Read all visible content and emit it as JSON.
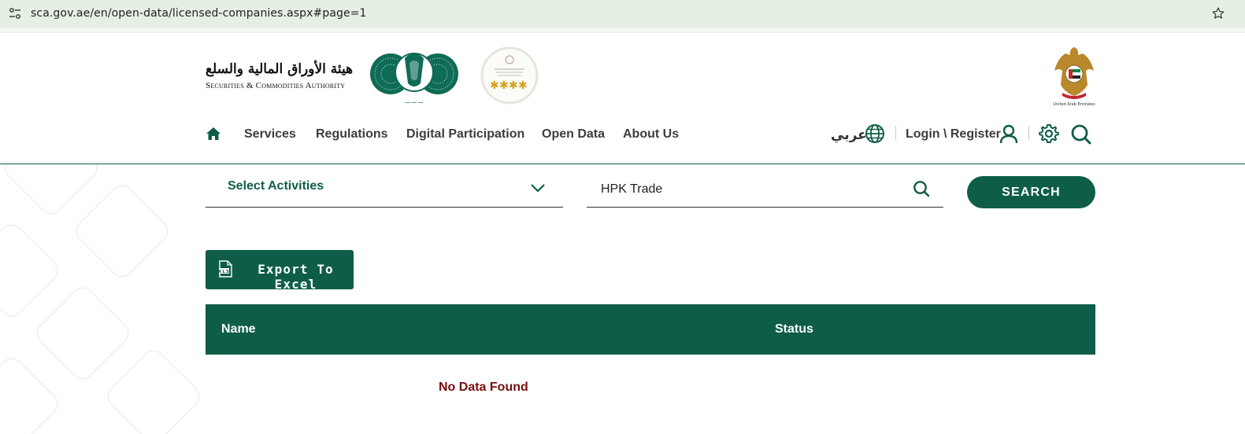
{
  "browser": {
    "url": "sca.gov.ae/en/open-data/licensed-companies.aspx#page=1"
  },
  "header": {
    "logo_ar": "هيئة الأوراق المالية والسلع",
    "logo_en": "Securities & Commodities Authority",
    "nav": [
      {
        "label": "Services"
      },
      {
        "label": "Regulations"
      },
      {
        "label": "Digital Participation"
      },
      {
        "label": "Open Data"
      },
      {
        "label": "About Us"
      }
    ],
    "language_link": "عربي",
    "login_label": "Login \\ Register",
    "icons": [
      "home-icon",
      "globe-icon",
      "user-icon",
      "gear-icon",
      "search-icon"
    ]
  },
  "filters": {
    "activities_label": "Select Activities",
    "search_value": "HPK Trade",
    "search_button": "SEARCH"
  },
  "export_label": "Export To Excel",
  "table": {
    "columns": [
      "Name",
      "Status"
    ],
    "empty_message": "No Data Found"
  },
  "colors": {
    "brand": "#0e5d49",
    "empty_text": "#7a0f0f",
    "urlbar": "#e5efe3"
  }
}
